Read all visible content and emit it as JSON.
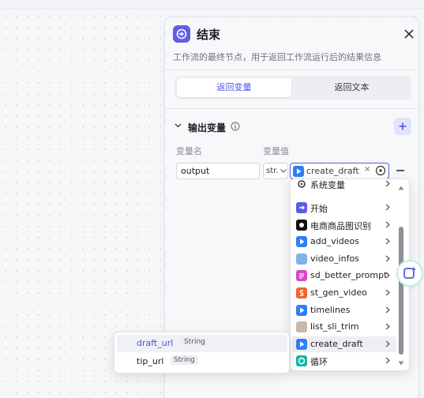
{
  "panel": {
    "title": "结束",
    "description": "工作流的最终节点，用于返回工作流运行后的结果信息",
    "tabs": [
      {
        "label": "返回变量",
        "active": true
      },
      {
        "label": "返回文本",
        "active": false
      }
    ]
  },
  "output_section": {
    "title": "输出变量",
    "col_name": "变量名",
    "col_value": "变量值",
    "row": {
      "name_value": "output",
      "type_value": "str.",
      "ref_value": "create_draft - d",
      "clear_glyph": "×"
    }
  },
  "variable_dropdown": {
    "partial_top_item": "系统变量",
    "items": [
      {
        "label": "开始",
        "icon": "start-icon",
        "color": "#5a5ce6"
      },
      {
        "label": "电商商品图识别",
        "icon": "product-recognition-icon",
        "color": "#111111"
      },
      {
        "label": "add_videos",
        "icon": "plugin-play-icon",
        "color": "#2d7ff9"
      },
      {
        "label": "video_infos",
        "icon": "video-info-icon",
        "color": "#7fb2e8"
      },
      {
        "label": "sd_better_prompt",
        "icon": "prompt-icon",
        "color": "#d946c9"
      },
      {
        "label": "st_gen_video",
        "icon": "gen-video-icon",
        "color": "#f0652f"
      },
      {
        "label": "timelines",
        "icon": "plugin-play-icon",
        "color": "#2d7ff9"
      },
      {
        "label": "list_sli_trim",
        "icon": "avatar-icon",
        "color": "#c9b8a8"
      },
      {
        "label": "create_draft",
        "icon": "plugin-play-icon",
        "color": "#2d7ff9",
        "highlighted": true
      },
      {
        "label": "循环",
        "icon": "loop-icon",
        "color": "#14b8a6"
      }
    ]
  },
  "field_popup": {
    "items": [
      {
        "name": "draft_url",
        "type": "String",
        "highlighted": true
      },
      {
        "name": "tip_url",
        "type": "String",
        "highlighted": false
      }
    ]
  },
  "colors": {
    "accent": "#4d53e8",
    "panel_bg": "#f7f8fa",
    "highlight": "#eeeff2"
  }
}
